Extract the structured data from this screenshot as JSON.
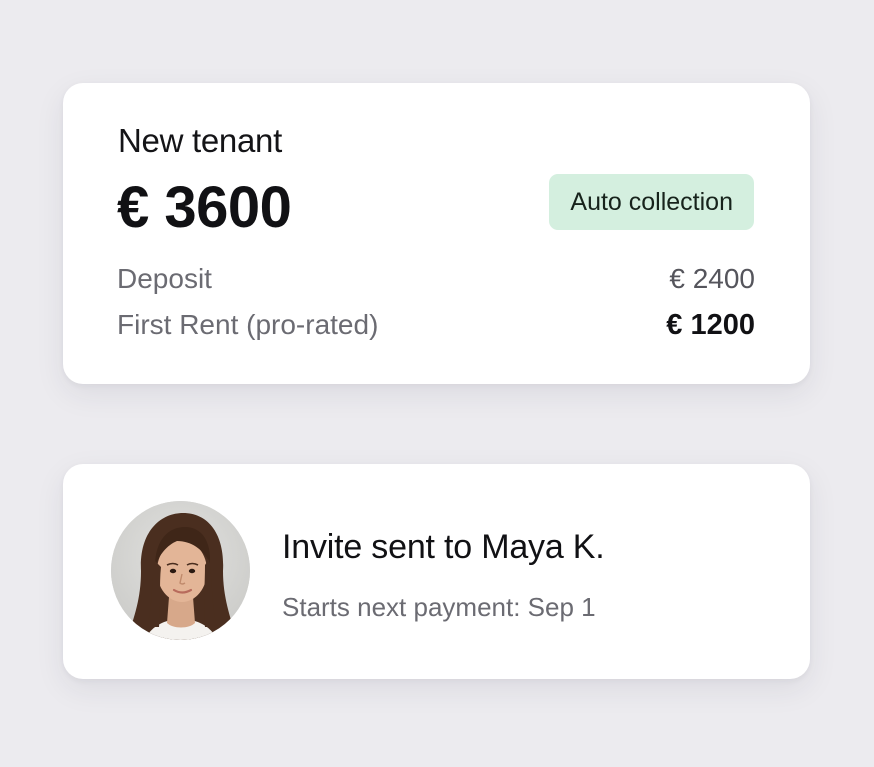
{
  "payment_card": {
    "title": "New tenant",
    "total": "€ 3600",
    "badge": "Auto collection",
    "lines": [
      {
        "label": "Deposit",
        "value": "€ 2400"
      },
      {
        "label": "First Rent (pro-rated)",
        "value": "€ 1200"
      }
    ]
  },
  "invite_card": {
    "title": "Invite sent to Maya K.",
    "subtitle": "Starts next payment: Sep 1"
  },
  "colors": {
    "background": "#ecebef",
    "card": "#ffffff",
    "badge_bg": "#d4efdf",
    "text_primary": "#111114",
    "text_muted": "#6b6b72"
  }
}
